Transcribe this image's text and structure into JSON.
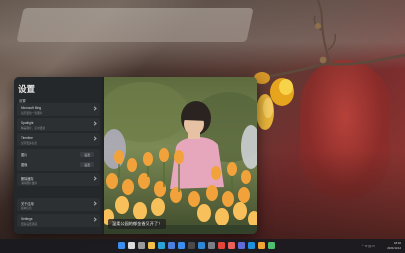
{
  "window": {
    "title": "设置",
    "section_label": "设置",
    "settings": [
      {
        "title": "Microsoft Bing",
        "desc": "每天更新一张图片"
      },
      {
        "title": "Spotlight",
        "desc": "精美图片，实时更新"
      },
      {
        "title": "Timeline",
        "desc": "显示更多信息"
      },
      {
        "title": "图片",
        "value": "设置",
        "desc": ""
      },
      {
        "title": "图像",
        "value": "设置",
        "desc": ""
      },
      {
        "title": "删除缓存",
        "desc": "清除图片缓存"
      },
      {
        "title": "关于应用",
        "desc": "版本信息"
      },
      {
        "title": "Settings",
        "desc": "更多设置选项"
      }
    ],
    "preview_caption": "温柔公园的郁金香又开了！"
  },
  "taskbar": {
    "icons": [
      {
        "name": "windows-start-icon",
        "color": "#3c8df0"
      },
      {
        "name": "search-icon",
        "color": "#dcdcdc"
      },
      {
        "name": "task-view-icon",
        "color": "#9a9a9a"
      },
      {
        "name": "file-explorer-icon",
        "color": "#f2c048"
      },
      {
        "name": "edge-icon",
        "color": "#29a3d8"
      },
      {
        "name": "store-icon",
        "color": "#4d7fe0"
      },
      {
        "name": "mail-icon",
        "color": "#3c8df0"
      },
      {
        "name": "terminal-icon",
        "color": "#4a4a4a"
      },
      {
        "name": "photos-icon",
        "color": "#2e86d6"
      },
      {
        "name": "settings-app-icon",
        "color": "#7a7f87"
      },
      {
        "name": "store-2-icon",
        "color": "#e3453a"
      },
      {
        "name": "music-icon",
        "color": "#e8615a"
      },
      {
        "name": "chat-icon",
        "color": "#5f6bd8"
      },
      {
        "name": "vscode-icon",
        "color": "#1e90e0"
      },
      {
        "name": "browser-icon",
        "color": "#f0a535"
      },
      {
        "name": "app-icon",
        "color": "#4fbf6f"
      }
    ],
    "tray": {
      "icons": "⌃ ᯤ ))) ▭",
      "time": "18:40",
      "date": "2021/11/12"
    }
  }
}
